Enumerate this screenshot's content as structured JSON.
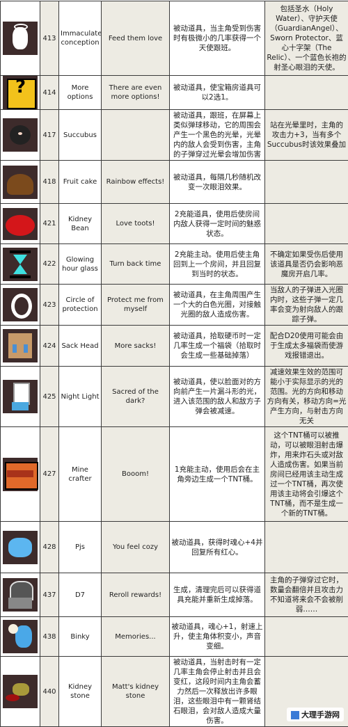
{
  "rows": [
    {
      "id": "413",
      "name": "Immaculate conception",
      "quote": "Feed them love",
      "desc": "被动道具，当主角受到伤害时有极微小的几率获得一个天使跟班。",
      "note": "包括圣水（Holy Water）、守护天使（GuardianAngel）、Sworn Protector、蓝心十字架（The Relic）、一个蓝色长袍的射圣心眼泪的天使。",
      "icon": "angel-baby-icon"
    },
    {
      "id": "414",
      "name": "More options",
      "quote": "There are even more options!",
      "desc": "被动道具，使宝箱房道具可以2选1。",
      "note": "",
      "icon": "question-block-icon"
    },
    {
      "id": "417",
      "name": "Succubus",
      "quote": "",
      "desc": "被动道具，跟班，在屏幕上类似弹球移动，它的周围会产生一个黑色的光晕，光晕内的敌人会受到伤害，主角的子弹穿过光晕会增加伤害",
      "note": "站在光晕里时，主角的攻击力+3，当有多个Succubus时该效果叠加",
      "icon": "succubus-icon"
    },
    {
      "id": "418",
      "name": "Fruit cake",
      "quote": "Rainbow effects!",
      "desc": "被动道具，每隔几秒随机改变一次眼泪效果。",
      "note": "",
      "icon": "fruit-cake-icon"
    },
    {
      "id": "421",
      "name": "Kidney Bean",
      "quote": "Love toots!",
      "desc": "2充能道具，使用后使房间内敌人获得一定时间的魅惑状态。",
      "note": "",
      "icon": "kidney-bean-icon"
    },
    {
      "id": "422",
      "name": "Glowing hour glass",
      "quote": "Turn back time",
      "desc": "2充能主动。使用后使主角回到上一个房间，并且回复到当时的状态。",
      "note": "不确定如果受伤后使用该道具是否仍会影响恶魔房开启几率。",
      "icon": "hourglass-icon"
    },
    {
      "id": "423",
      "name": "Circle of protection",
      "quote": "Protect me from myself",
      "desc": "被动道具，在主角周围产生一个大的白色光圈，对接触光圈的敌人造成伤害。",
      "note": "当敌人的子弹进入光圈内时，这些子弹一定几率会变为射向敌人的跟踪子弹。",
      "icon": "ring-icon"
    },
    {
      "id": "424",
      "name": "Sack Head",
      "quote": "More sacks!",
      "desc": "被动道具，拾取硬币时一定几率生成一个福袋（拾取时会生成一些基础掉落）",
      "note": "配合D20使用可能会由于生成太多福袋而使游戏报错退出。",
      "icon": "sack-head-icon"
    },
    {
      "id": "425",
      "name": "Night Light",
      "quote": "Sacred of the dark?",
      "desc": "被动道具，使以脸面对的方向前产生一片漏斗形的光，进入该范围的敌人和敌方子弹会被减速。",
      "note": "减速效果生效的范围可能小于实际显示的光的范围。光的方向和移动方向有关，移动方向=光产生方向，与射击方向无关",
      "icon": "night-light-icon"
    },
    {
      "id": "427",
      "name": "Mine crafter",
      "quote": "Booom!",
      "desc": "1充能主动，使用后会在主角旁边生成一个TNT桶。",
      "note": "这个TNT桶可以被推动，可以被眼泪射击爆炸，用来炸石头或对敌人造成伤害。如果当前房间已经用该主动生成过一个TNT桶，再次使用该主动将会引爆这个TNT桶，而不是生成一个新的TNT桶。",
      "icon": "tnt-icon"
    },
    {
      "id": "428",
      "name": "Pjs",
      "quote": "You feel cozy",
      "desc": "被动道具，获得时魂心+4并回复所有红心。",
      "note": "",
      "icon": "pajamas-icon"
    },
    {
      "id": "437",
      "name": "D7",
      "quote": "Reroll rewards!",
      "desc": "生成，清理完后可以获得道具充能并重新生成掉落。",
      "note": "主角的子弹穿过它时，数量会翻倍并且攻击力不知道将来会不会被削弱……",
      "icon": "d7-icon"
    },
    {
      "id": "438",
      "name": "Binky",
      "quote": "Memories...",
      "desc": "被动道具，魂心+1，射速上升，使主角体积变小，声音变细。",
      "note": "",
      "icon": "pacifier-icon"
    },
    {
      "id": "440",
      "name": "Kidney stone",
      "quote": "Matt's kidney stone",
      "desc": "被动道具，当射击时有一定几率主角会停止射击并且会变红，这段时间内主角会蓄力然后一次释放出许多眼泪，这些眼泪中有一颗肾结石眼泪，会对敌人造成大量伤害。",
      "note": "",
      "icon": "kidney-stone-icon"
    }
  ],
  "watermark_logo": "大理手游网"
}
